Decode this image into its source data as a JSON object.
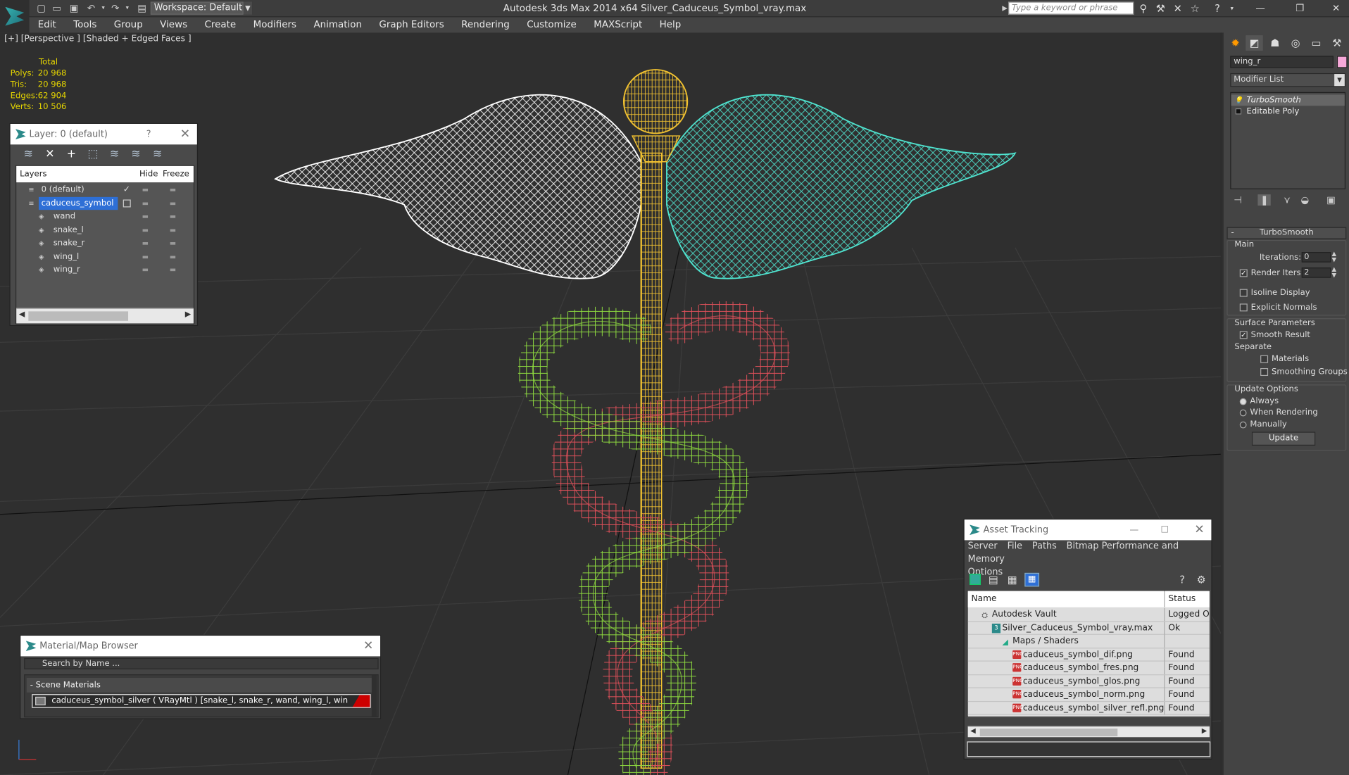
{
  "titlebar": {
    "workspace_label": "Workspace: Default",
    "app_title": "Autodesk 3ds Max  2014 x64    Silver_Caduceus_Symbol_vray.max",
    "search_placeholder": "Type a keyword or phrase"
  },
  "menu": [
    "Edit",
    "Tools",
    "Group",
    "Views",
    "Create",
    "Modifiers",
    "Animation",
    "Graph Editors",
    "Rendering",
    "Customize",
    "MAXScript",
    "Help"
  ],
  "viewport": {
    "label": "[+] [Perspective ] [Shaded + Edged Faces ]",
    "stats": {
      "header": "Total",
      "rows": [
        {
          "label": "Polys:",
          "value": "20 968"
        },
        {
          "label": "Tris:",
          "value": "20 968"
        },
        {
          "label": "Edges:",
          "value": "62 904"
        },
        {
          "label": "Verts:",
          "value": "10 506"
        }
      ]
    }
  },
  "layer_panel": {
    "title": "Layer: 0 (default)",
    "help": "?",
    "columns": [
      "Layers",
      "Hide",
      "Freeze"
    ],
    "rows": [
      {
        "name": "0 (default)",
        "indent": 0,
        "selected": false
      },
      {
        "name": "caduceus_symbol",
        "indent": 0,
        "selected": true
      },
      {
        "name": "wand",
        "indent": 1,
        "selected": false
      },
      {
        "name": "snake_l",
        "indent": 1,
        "selected": false
      },
      {
        "name": "snake_r",
        "indent": 1,
        "selected": false
      },
      {
        "name": "wing_l",
        "indent": 1,
        "selected": false
      },
      {
        "name": "wing_r",
        "indent": 1,
        "selected": false
      }
    ]
  },
  "asset_panel": {
    "title": "Asset Tracking",
    "menu": [
      "Server",
      "File",
      "Paths",
      "Bitmap Performance and Memory",
      "Options"
    ],
    "columns": [
      "Name",
      "Status"
    ],
    "rows": [
      {
        "name": "Autodesk Vault",
        "status": "Logged Ou",
        "indent": 1,
        "icon": "vault"
      },
      {
        "name": "Silver_Caduceus_Symbol_vray.max",
        "status": "Ok",
        "indent": 2,
        "icon": "max"
      },
      {
        "name": "Maps / Shaders",
        "status": "",
        "indent": 3,
        "icon": "maps"
      },
      {
        "name": "caduceus_symbol_dif.png",
        "status": "Found",
        "indent": 4,
        "icon": "png"
      },
      {
        "name": "caduceus_symbol_fres.png",
        "status": "Found",
        "indent": 4,
        "icon": "png"
      },
      {
        "name": "caduceus_symbol_glos.png",
        "status": "Found",
        "indent": 4,
        "icon": "png"
      },
      {
        "name": "caduceus_symbol_norm.png",
        "status": "Found",
        "indent": 4,
        "icon": "png"
      },
      {
        "name": "caduceus_symbol_silver_refl.png",
        "status": "Found",
        "indent": 4,
        "icon": "png"
      }
    ]
  },
  "material_panel": {
    "title": "Material/Map Browser",
    "search_placeholder": "Search by Name ...",
    "group": "- Scene Materials",
    "item": "caduceus_symbol_silver  ( VRayMtl )  [snake_l, snake_r, wand, wing_l, wing_r]"
  },
  "command_panel": {
    "object_name": "wing_r",
    "object_color": "#f6a8d8",
    "modifier_list": "Modifier List",
    "stack": [
      "TurboSmooth",
      "Editable Poly"
    ],
    "rollout_title": "TurboSmooth",
    "main_label": "Main",
    "iterations_label": "Iterations:",
    "iterations_value": "0",
    "render_iters_label": "Render Iters:",
    "render_iters_value": "2",
    "render_iters_checked": true,
    "isoline_label": "Isoline Display",
    "explicit_label": "Explicit Normals",
    "surface_label": "Surface Parameters",
    "smooth_result_label": "Smooth Result",
    "separate_label": "Separate",
    "materials_label": "Materials",
    "smoothing_groups_label": "Smoothing Groups",
    "update_options_label": "Update Options",
    "update_always": "Always",
    "update_when_rendering": "When Rendering",
    "update_manually": "Manually",
    "update_button": "Update"
  },
  "colors": {
    "wing_left": "#ffffff",
    "wing_right": "#4fe3cf",
    "wand": "#f2c230",
    "snake_left": "#8edb3f",
    "snake_right": "#e0505a",
    "selection_blue": "#2e6fd6"
  }
}
